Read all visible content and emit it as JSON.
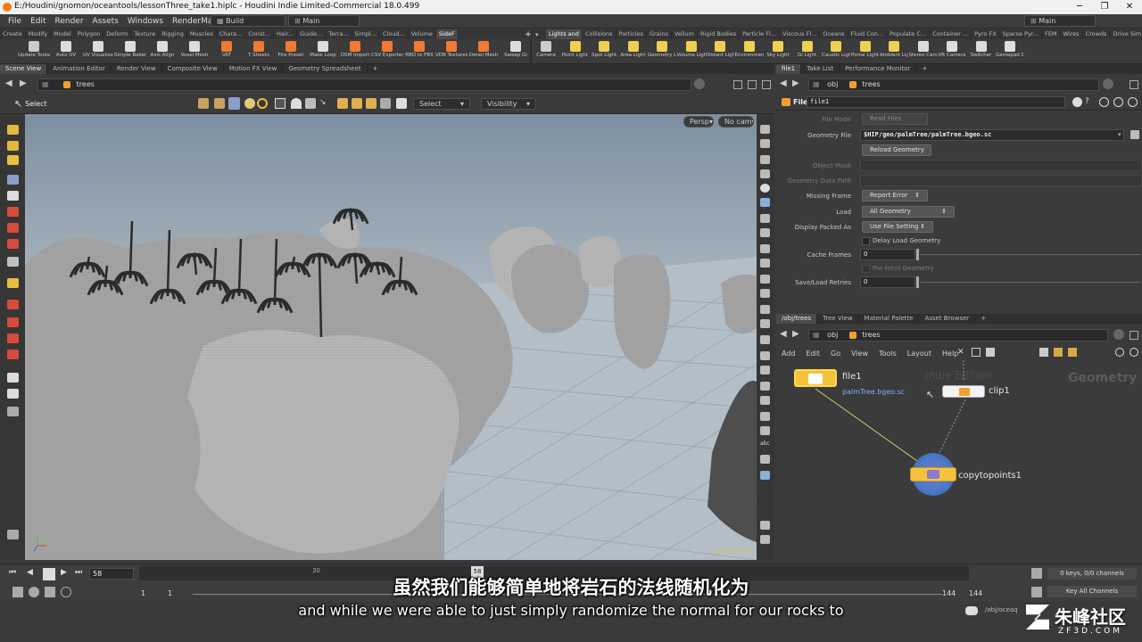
{
  "window": {
    "title": "E:/Houdini/gnomon/oceantools/lessonThree_take1.hiplc - Houdini Indie Limited-Commercial 18.0.499",
    "min_icon": "minimize-icon",
    "max_icon": "maximize-icon",
    "close_icon": "close-icon"
  },
  "menu": {
    "items": [
      "File",
      "Edit",
      "Render",
      "Assets",
      "Windows",
      "RenderMan",
      "Help"
    ],
    "build": "Build",
    "main": "Main",
    "main_right": "Main"
  },
  "shelf_tabs_left": [
    "Create",
    "Modify",
    "Model",
    "Polygon",
    "Deform",
    "Texture",
    "Rigging",
    "Muscles",
    "Chara...",
    "Const...",
    "Hair...",
    "Guide...",
    "Terra...",
    "Simpl...",
    "Cloud...",
    "Volume",
    "SideF"
  ],
  "shelf_tabs_right": [
    "Lights and",
    "Collisions",
    "Particles",
    "Grains",
    "Vellum",
    "Rigid Bodies",
    "Particle Fl...",
    "Viscous Fl...",
    "Oceans",
    "Fluid Con...",
    "Populate C...",
    "Container ...",
    "Pyro FX",
    "Sparse Pyr...",
    "FEM",
    "Wires",
    "Crowds",
    "Drive Sim..."
  ],
  "shelf_tools_left": [
    "Update Toolset",
    "Auto UV",
    "UV Visualize",
    "Simple Baker",
    "Axis Align",
    "Voxel Mesh",
    "VAT",
    "T Sheets",
    "Fire Preset",
    "Make Loop",
    "OSM Import",
    "CSV Exporter",
    "RBD to FBX",
    "VDB Textures",
    "Detail Mesh",
    "Sweep Gi"
  ],
  "shelf_tools_right": [
    "Camera",
    "Point Light",
    "Spot Light",
    "Area Light",
    "Geometry Light",
    "Volume Light",
    "Distant Light",
    "Environment Light",
    "Sky Light",
    "GI Light",
    "Caustic Light",
    "Portal Light",
    "Ambient Light",
    "Stereo Camera",
    "VR Camera",
    "Switcher",
    "Gamepad Camera"
  ],
  "left_pane": {
    "tabs": [
      "Scene View",
      "Animation Editor",
      "Render View",
      "Composite View",
      "Motion FX View",
      "Geometry Spreadsheet"
    ],
    "path_obj": "obj",
    "path_node": "trees",
    "tool_label": "Select",
    "select_dd": "Select",
    "visibility_dd": "Visibility",
    "persp": "Persp",
    "cam": "No cam",
    "indie_watermark": "Indie Edition"
  },
  "param_pane": {
    "tabs": [
      "file1",
      "Take List",
      "Performance Monitor"
    ],
    "path_obj": "obj",
    "path_node": "trees",
    "node_type": "File",
    "node_name": "file1",
    "file_mode_label": "File Mode",
    "file_mode_value": "Read Files",
    "geo_file_label": "Geometry File",
    "geo_file_value": "$HIP/geo/palmTree/palmTree.bgeo.sc",
    "reload_button": "Reload Geometry",
    "object_mask_label": "Object Mask",
    "geo_data_path_label": "Geometry Data Path",
    "missing_frame_label": "Missing Frame",
    "missing_frame_value": "Report Error",
    "load_label": "Load",
    "load_value": "All Geometry",
    "display_packed_label": "Display Packed As",
    "display_packed_value": "Use File Setting",
    "delay_load_label": "Delay Load Geometry",
    "cache_frames_label": "Cache Frames",
    "cache_frames_value": "0",
    "prefetch_label": "Pre-fetch Geometry",
    "save_load_label": "Save/Load Retries",
    "save_load_value": "0"
  },
  "net_pane": {
    "tabs": [
      "/obj/trees",
      "Tree View",
      "Material Palette",
      "Asset Browser"
    ],
    "path_obj": "obj",
    "path_node": "trees",
    "menu": [
      "Add",
      "Edit",
      "Go",
      "View",
      "Tools",
      "Layout",
      "Help"
    ],
    "watermark_indie": "Indie Edition",
    "watermark_context": "Geometry",
    "nodes": {
      "file1": "file1",
      "file1_sub": "palmTree.bgeo.sc",
      "clip1": "clip1",
      "copy": "copytopoints1"
    }
  },
  "timeline": {
    "frame": "58",
    "marker": "58",
    "tick_30": "30",
    "start": "1",
    "start2": "1",
    "end": "144",
    "end2": "144",
    "keys": "0 keys, 0/0 channels",
    "key_all": "Key All Channels",
    "path": "/obj/oceaq"
  },
  "subtitles": {
    "cn": "虽然我们能够简单地将岩石的法线随机化为",
    "en": "and while we were able to just simply randomize the normal for our rocks to"
  },
  "brand": {
    "name": "朱峰社区",
    "url": "ZF3D.COM"
  },
  "colors": {
    "accent_orange": "#f0a030",
    "node_yellow": "#f5c33b",
    "node_selected": "#ffd84a",
    "sky": "#9fb0bf",
    "rock": "#9e9e9e"
  }
}
